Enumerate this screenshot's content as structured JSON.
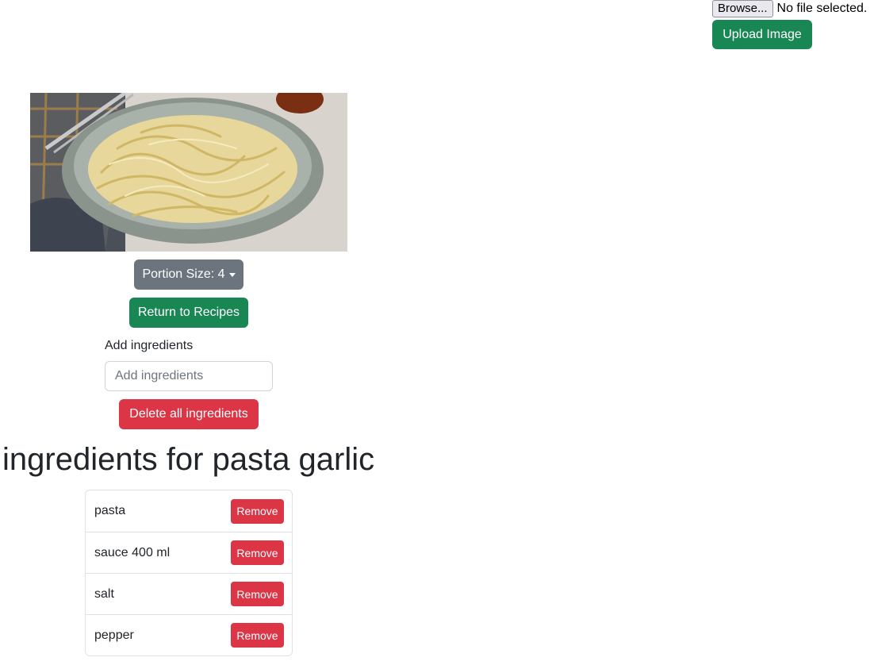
{
  "upload": {
    "browse_label": "Browse...",
    "file_status": "No file selected.",
    "upload_label": "Upload Image"
  },
  "recipe": {
    "image_alt": "bowl of creamy garlic pasta",
    "portion_label": "Portion Size: 4",
    "return_label": "Return to Recipes",
    "add_label": "Add ingredients",
    "add_placeholder": "Add ingredients",
    "delete_all_label": "Delete all ingredients",
    "heading": "ingredients for pasta garlic"
  },
  "ingredients": [
    {
      "name": "pasta",
      "remove_label": "Remove"
    },
    {
      "name": "sauce 400 ml",
      "remove_label": "Remove"
    },
    {
      "name": "salt",
      "remove_label": "Remove"
    },
    {
      "name": "pepper",
      "remove_label": "Remove"
    }
  ],
  "colors": {
    "success": "#198754",
    "secondary": "#6c757d",
    "danger": "#dc3545"
  }
}
